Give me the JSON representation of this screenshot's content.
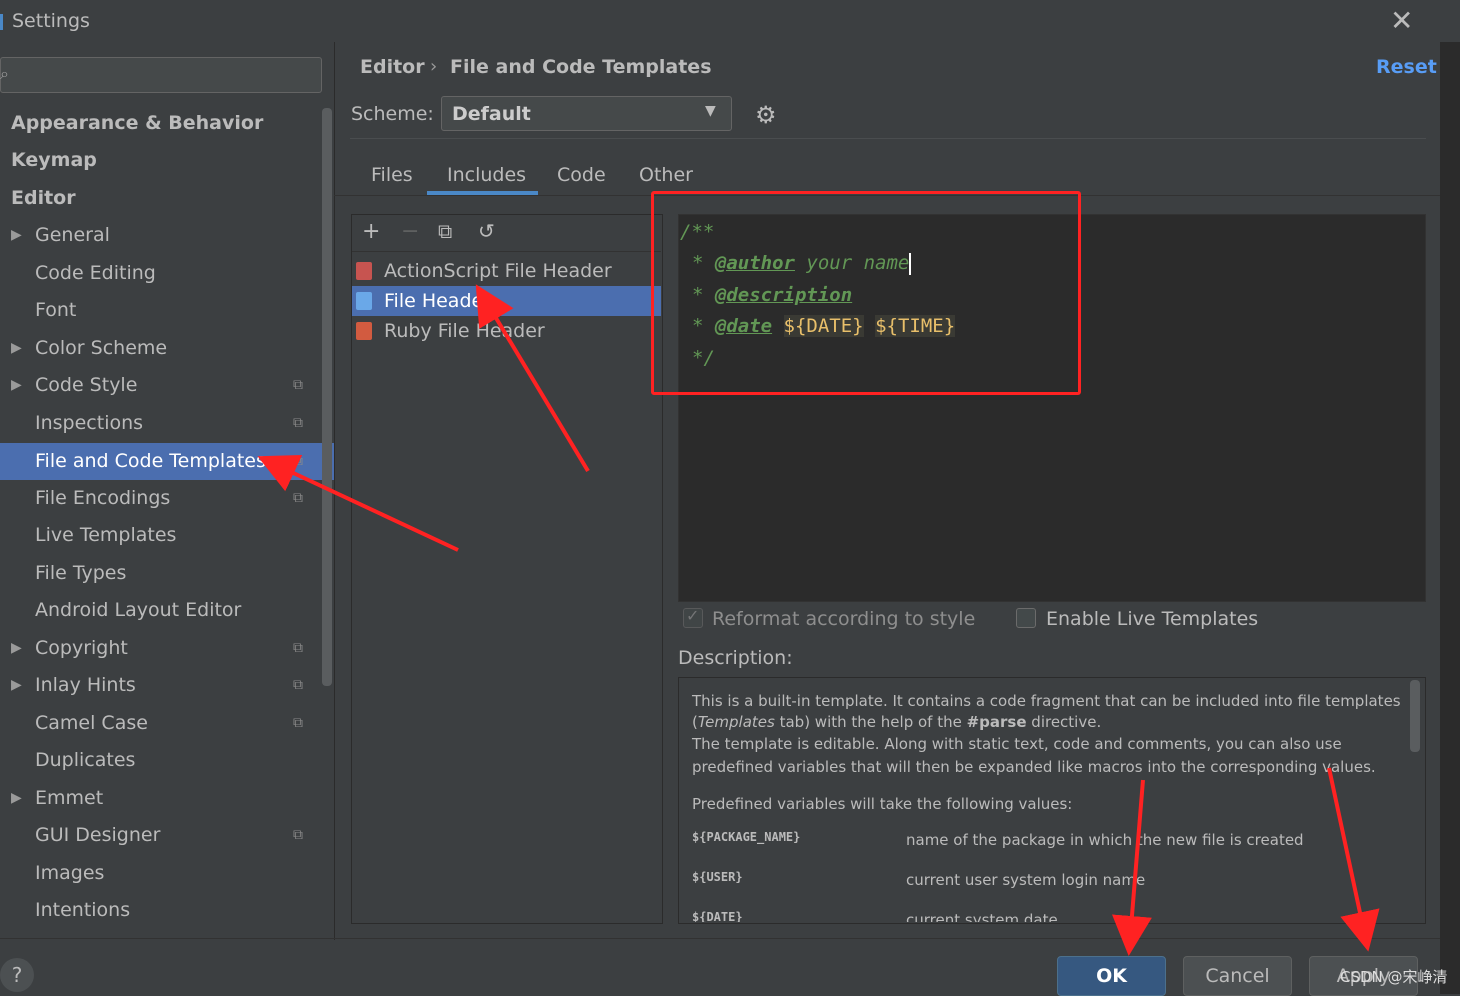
{
  "window": {
    "title": "Settings"
  },
  "search": {
    "placeholder": ""
  },
  "sidebar": {
    "items": [
      {
        "label": "Appearance & Behavior"
      },
      {
        "label": "Keymap"
      },
      {
        "label": "Editor"
      },
      {
        "label": "General"
      },
      {
        "label": "Code Editing"
      },
      {
        "label": "Font"
      },
      {
        "label": "Color Scheme"
      },
      {
        "label": "Code Style"
      },
      {
        "label": "Inspections"
      },
      {
        "label": "File and Code Templates"
      },
      {
        "label": "File Encodings"
      },
      {
        "label": "Live Templates"
      },
      {
        "label": "File Types"
      },
      {
        "label": "Android Layout Editor"
      },
      {
        "label": "Copyright"
      },
      {
        "label": "Inlay Hints"
      },
      {
        "label": "Camel Case"
      },
      {
        "label": "Duplicates"
      },
      {
        "label": "Emmet"
      },
      {
        "label": "GUI Designer"
      },
      {
        "label": "Images"
      },
      {
        "label": "Intentions"
      }
    ]
  },
  "header": {
    "breadcrumb_parent": "Editor",
    "breadcrumb_separator": "›",
    "breadcrumb_current": "File and Code Templates",
    "reset_label": "Reset",
    "scheme_label": "Scheme:",
    "scheme_value": "Default"
  },
  "tabs": [
    {
      "label": "Files"
    },
    {
      "label": "Includes"
    },
    {
      "label": "Code"
    },
    {
      "label": "Other"
    }
  ],
  "template_list": {
    "items": [
      {
        "label": "ActionScript File Header"
      },
      {
        "label": "File Header"
      },
      {
        "label": "Ruby File Header"
      }
    ]
  },
  "editor": {
    "line1": "/**",
    "line2_star": "* ",
    "line2_tag": "@author",
    "line2_text": " your name",
    "line3_star": "* ",
    "line3_tag": "@description",
    "line4_star": "* ",
    "line4_tag": "@date",
    "line4_var1": "${DATE}",
    "line4_var2": "${TIME}",
    "line5": "*/"
  },
  "options": {
    "reformat_label": "Reformat according to style",
    "reformat_checked": true,
    "live_templates_label": "Enable Live Templates",
    "live_templates_checked": false
  },
  "description": {
    "label": "Description:",
    "p1_line1": "This is a built-in template. It contains a code fragment that can be included into file templates",
    "p1_line2_a": "(",
    "p1_line2_b": "Templates",
    "p1_line2_c": " tab) with the help of the ",
    "p1_line2_d": "#parse",
    "p1_line2_e": " directive.",
    "p1_line3": "The template is editable. Along with static text, code and comments, you can also use",
    "p1_line4": "predefined variables that will then be expanded like macros into the corresponding values.",
    "p2": "Predefined variables will take the following values:",
    "vars": [
      {
        "name": "${PACKAGE_NAME}",
        "value": "name of the package in which the new file is created"
      },
      {
        "name": "${USER}",
        "value": "current user system login name"
      },
      {
        "name": "${DATE}",
        "value": "current system date"
      }
    ]
  },
  "footer": {
    "help_label": "?",
    "ok_label": "OK",
    "cancel_label": "Cancel",
    "apply_label": "Apply",
    "watermark": "CSDN @宋峥清"
  },
  "colors": {
    "background": "#3c3f41",
    "selection": "#4b6eaf",
    "accent_link": "#589df6",
    "annotation": "#ff2222"
  }
}
